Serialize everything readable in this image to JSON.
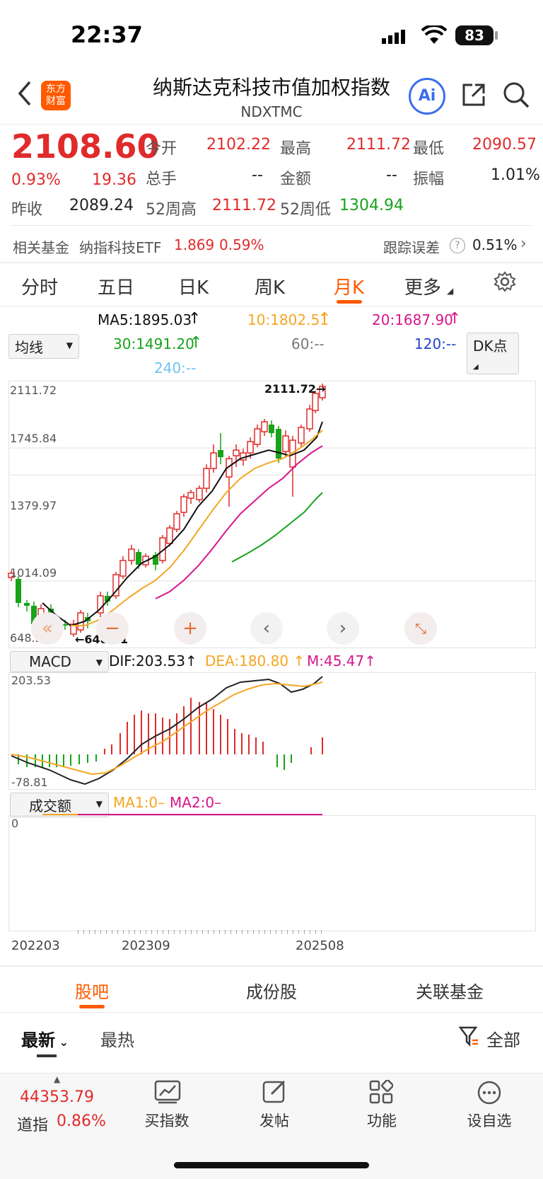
{
  "status": {
    "time": "22:37",
    "battery": "83"
  },
  "header": {
    "title": "纳斯达克科技市值加权指数",
    "code": "NDXTMC",
    "logo_line1": "东方",
    "logo_line2": "财富",
    "ai_label": "Ai"
  },
  "quote": {
    "price": "2108.60",
    "pct": "0.93%",
    "change": "19.36",
    "prev_close_label": "昨收",
    "prev_close": "2089.24",
    "open_label": "今开",
    "open": "2102.22",
    "volume_label": "总手",
    "volume": "--",
    "w52_high_label": "52周高",
    "w52_high": "2111.72",
    "high_label": "最高",
    "high": "2111.72",
    "amount_label": "金额",
    "amount": "--",
    "w52_low_label": "52周低",
    "w52_low": "1304.94",
    "low_label": "最低",
    "low": "2090.57",
    "amp_label": "振幅",
    "amp": "1.01%"
  },
  "fund": {
    "label": "相关基金",
    "name": "纳指科技ETF",
    "price": "1.869",
    "pct": "0.59%",
    "track_label": "跟踪误差",
    "track_val": "0.51%"
  },
  "tabs": [
    "分时",
    "五日",
    "日K",
    "周K",
    "月K",
    "更多"
  ],
  "active_tab": "月K",
  "ma": {
    "select": "均线",
    "ma5": "MA5:1895.03",
    "ma10": "10:1802.51",
    "ma20": "20:1687.90",
    "ma30": "30:1491.20",
    "ma60": "60:--",
    "ma120": "120:--",
    "ma240": "240:--",
    "dk": "DK点"
  },
  "kchart": {
    "y_labels": [
      "2111.72",
      "1745.84",
      "1379.97",
      "1014.09",
      "648.21"
    ],
    "high_mark": "2111.72",
    "low_mark": "648.21"
  },
  "macd": {
    "select": "MACD",
    "dif": "DIF:203.53",
    "dea": "DEA:180.80",
    "m": "M:45.47",
    "top": "203.53",
    "bottom": "-78.81"
  },
  "volume": {
    "select": "成交额",
    "ma1": "MA1:0",
    "ma2": "MA2:0",
    "zero": "0"
  },
  "x_labels": [
    "202203",
    "202309",
    "202508"
  ],
  "bottom_tabs": [
    "股吧",
    "成份股",
    "关联基金"
  ],
  "filter": {
    "latest": "最新",
    "hot": "最热",
    "all": "全部"
  },
  "nav": {
    "index_value": "44353.79",
    "index_name": "道指",
    "index_pct": "0.86%",
    "items": [
      "买指数",
      "发帖",
      "功能",
      "设自选"
    ]
  },
  "colors": {
    "red": "#e02b2b",
    "green": "#17a31a",
    "accent": "#ff5a00",
    "ma5": "#111111",
    "ma10": "#f5a623",
    "ma20": "#d6168c",
    "ma30": "#17a31a",
    "ma120": "#2244cc",
    "ma240": "#6fc3f0"
  }
}
